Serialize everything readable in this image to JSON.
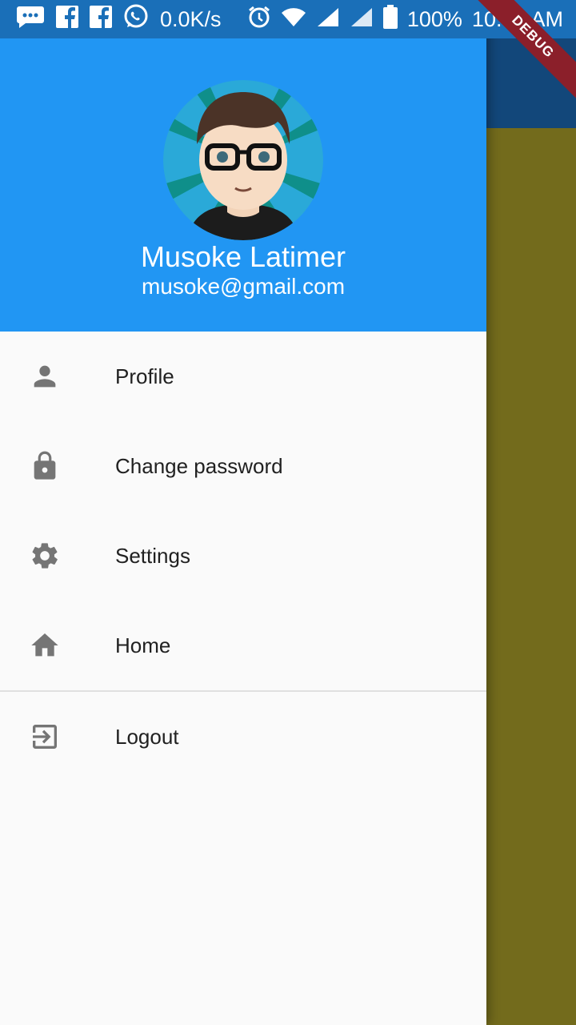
{
  "status_bar": {
    "speed": "0.0K/s",
    "battery": "100%",
    "time": "10:42 AM"
  },
  "debug_banner": "DEBUG",
  "drawer": {
    "user": {
      "name": "Musoke Latimer",
      "email": "musoke@gmail.com"
    },
    "items": [
      {
        "label": "Profile",
        "icon": "person-icon"
      },
      {
        "label": "Change password",
        "icon": "lock-icon"
      },
      {
        "label": "Settings",
        "icon": "gear-icon"
      },
      {
        "label": "Home",
        "icon": "home-icon"
      }
    ],
    "logout": {
      "label": "Logout",
      "icon": "exit-icon"
    }
  },
  "colors": {
    "header": "#2196f3",
    "status_bar": "#1a6fb8",
    "scrim_appbar": "#12477a",
    "scrim_body": "#736b1c",
    "icon": "#757575"
  }
}
